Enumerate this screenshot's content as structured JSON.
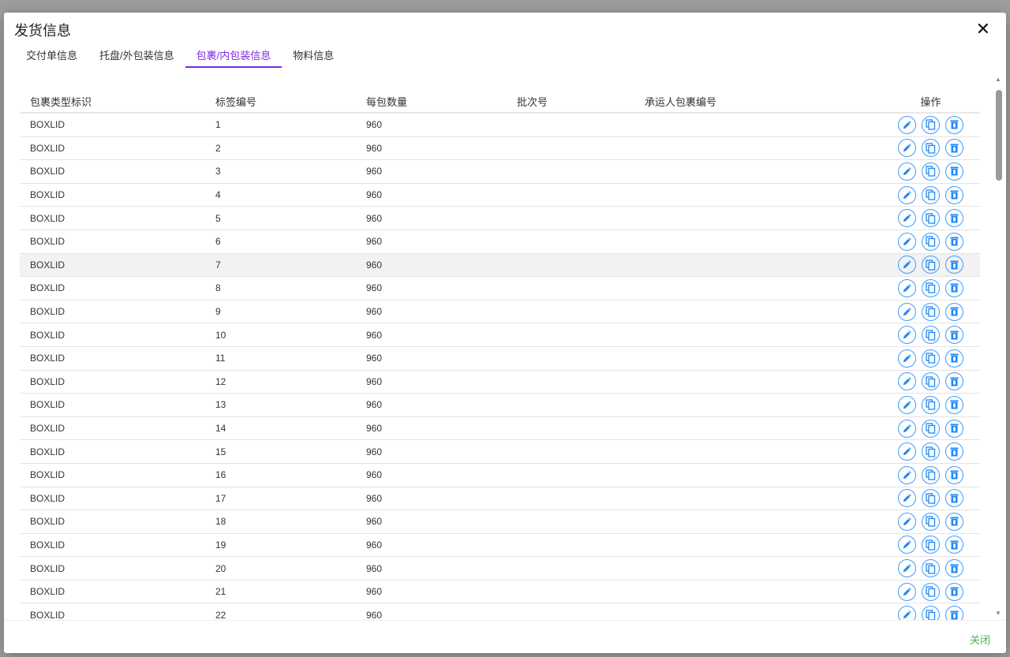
{
  "dialog": {
    "title": "发货信息",
    "close_label": "关闭"
  },
  "tabs": [
    {
      "label": "交付单信息"
    },
    {
      "label": "托盘/外包装信息"
    },
    {
      "label": "包裹/内包装信息",
      "active": true
    },
    {
      "label": "物料信息"
    }
  ],
  "table": {
    "columns": [
      "包裹类型标识",
      "标签编号",
      "每包数量",
      "批次号",
      "承运人包裹编号",
      "操作"
    ],
    "rows": [
      [
        "BOXLID",
        "1",
        "960",
        "",
        ""
      ],
      [
        "BOXLID",
        "2",
        "960",
        "",
        ""
      ],
      [
        "BOXLID",
        "3",
        "960",
        "",
        ""
      ],
      [
        "BOXLID",
        "4",
        "960",
        "",
        ""
      ],
      [
        "BOXLID",
        "5",
        "960",
        "",
        ""
      ],
      [
        "BOXLID",
        "6",
        "960",
        "",
        ""
      ],
      [
        "BOXLID",
        "7",
        "960",
        "",
        ""
      ],
      [
        "BOXLID",
        "8",
        "960",
        "",
        ""
      ],
      [
        "BOXLID",
        "9",
        "960",
        "",
        ""
      ],
      [
        "BOXLID",
        "10",
        "960",
        "",
        ""
      ],
      [
        "BOXLID",
        "11",
        "960",
        "",
        ""
      ],
      [
        "BOXLID",
        "12",
        "960",
        "",
        ""
      ],
      [
        "BOXLID",
        "13",
        "960",
        "",
        ""
      ],
      [
        "BOXLID",
        "14",
        "960",
        "",
        ""
      ],
      [
        "BOXLID",
        "15",
        "960",
        "",
        ""
      ],
      [
        "BOXLID",
        "16",
        "960",
        "",
        ""
      ],
      [
        "BOXLID",
        "17",
        "960",
        "",
        ""
      ],
      [
        "BOXLID",
        "18",
        "960",
        "",
        ""
      ],
      [
        "BOXLID",
        "19",
        "960",
        "",
        ""
      ],
      [
        "BOXLID",
        "20",
        "960",
        "",
        ""
      ],
      [
        "BOXLID",
        "21",
        "960",
        "",
        ""
      ],
      [
        "BOXLID",
        "22",
        "960",
        "",
        ""
      ]
    ],
    "highlighted_row": 6
  },
  "colors": {
    "accent": "#7c2ae8",
    "icon": "#1e88f5",
    "ok": "#4caf50"
  }
}
